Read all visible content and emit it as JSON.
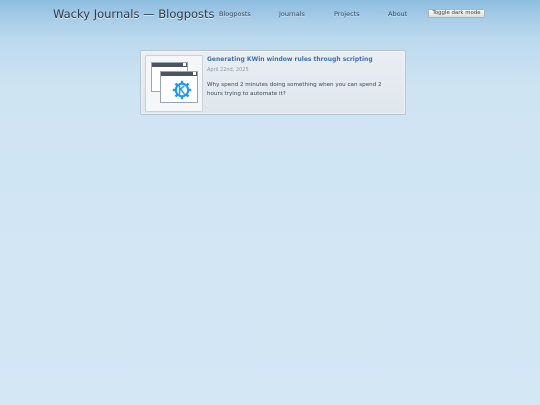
{
  "site": {
    "title": "Wacky Journals — Blogposts"
  },
  "nav": {
    "items": [
      {
        "label": "Blogposts"
      },
      {
        "label": "Journals"
      },
      {
        "label": "Projects"
      },
      {
        "label": "About"
      }
    ]
  },
  "toggle": {
    "label": "Toggle dark mode"
  },
  "posts": [
    {
      "title": "Generating KWin window rules through scripting",
      "date": "April 22nd, 2025",
      "excerpt": "Why spend 2 minutes doing something when you can spend 2 hours trying to automate it?",
      "thumbnail_icon": "kde-logo-icon"
    }
  ],
  "colors": {
    "link": "#3a6fb0",
    "kde_blue": "#1d99f3",
    "header_bg": "#8dbde0"
  }
}
